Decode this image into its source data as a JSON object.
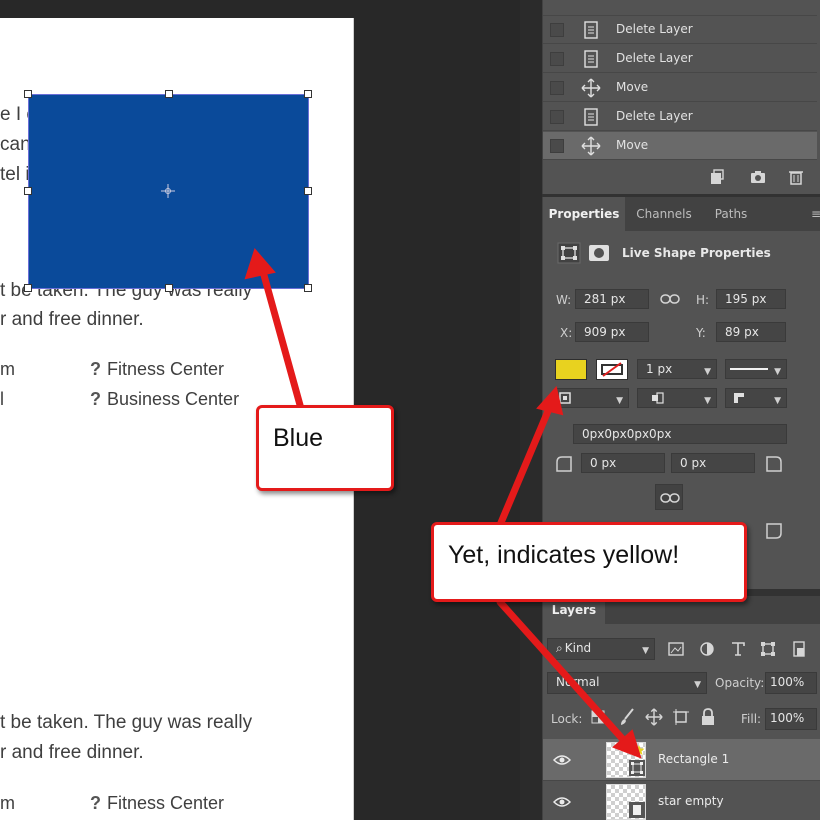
{
  "document": {
    "text_lines": [
      "e I c",
      "can",
      "tel i",
      "t be taken. The guy was really",
      "r and free dinner.",
      "t be taken. The guy was really",
      "r and free dinner."
    ],
    "amenities": [
      {
        "left": "m",
        "right": "Fitness Center"
      },
      {
        "left": "l",
        "right": "Business Center"
      },
      {
        "left": "m",
        "right": "Fitness Center"
      }
    ],
    "amenity_glyph": "?",
    "shape_color": "#0a4a9a"
  },
  "history": {
    "items": [
      {
        "label": "Delete Layer",
        "icon": "document-icon"
      },
      {
        "label": "Delete Layer",
        "icon": "document-icon"
      },
      {
        "label": "Move",
        "icon": "move-icon"
      },
      {
        "label": "Delete Layer",
        "icon": "document-icon"
      },
      {
        "label": "Move",
        "icon": "move-icon",
        "selected": true
      }
    ]
  },
  "properties": {
    "tabs": [
      "Properties",
      "Channels",
      "Paths"
    ],
    "active_tab": "Properties",
    "section_title": "Live Shape Properties",
    "w_label": "W:",
    "w_value": "281 px",
    "h_label": "H:",
    "h_value": "195 px",
    "x_label": "X:",
    "x_value": "909 px",
    "y_label": "Y:",
    "y_value": "89 px",
    "fill_color": "#e8d21f",
    "stroke_width": "1 px",
    "corner_radius_all": "0px0px0px0px",
    "corner_tl": "0 px",
    "corner_tr": "0 px"
  },
  "layers": {
    "tab": "Layers",
    "kind_label": "Kind",
    "blend_mode": "Normal",
    "opacity_label": "Opacity:",
    "opacity_value": "100%",
    "lock_label": "Lock:",
    "fill_label": "Fill:",
    "fill_value": "100%",
    "items": [
      {
        "name": "Rectangle 1",
        "selected": true
      },
      {
        "name": "star empty",
        "selected": false
      }
    ]
  },
  "annotations": {
    "blue_callout": "Blue",
    "yellow_callout": "Yet, indicates yellow!",
    "callout_color": "#e41a1a"
  }
}
